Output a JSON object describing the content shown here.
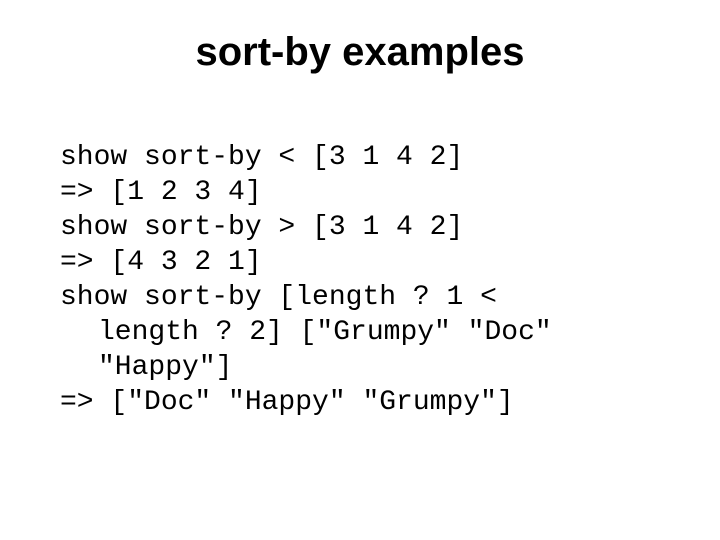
{
  "title": "sort-by examples",
  "code": {
    "l1": "show sort-by < [3 1 4 2]",
    "l2": "=> [1 2 3 4]",
    "l3": "show sort-by > [3 1 4 2]",
    "l4": "=> [4 3 2 1]",
    "l5": "show sort-by [length ? 1 <",
    "l6": "length ? 2] [\"Grumpy\" \"Doc\"",
    "l7": "\"Happy\"]",
    "l8": "=> [\"Doc\" \"Happy\" \"Grumpy\"]"
  }
}
